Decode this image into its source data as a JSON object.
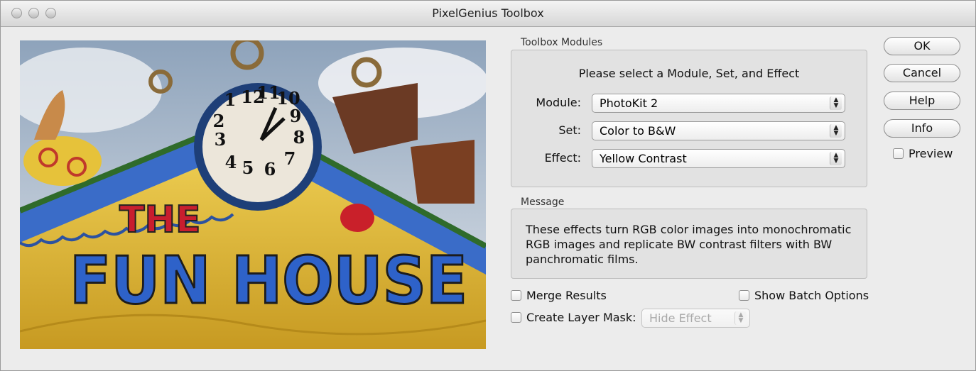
{
  "window": {
    "title": "PixelGenius Toolbox"
  },
  "preview_image": {
    "description_icon": "preview-photo",
    "sign_text_line1": "THE",
    "sign_text_line2": "FUN HOUSE",
    "clock_numbers": [
      "12",
      "11",
      "10",
      "9",
      "8",
      "7",
      "6",
      "5",
      "4",
      "3",
      "2",
      "1"
    ]
  },
  "modules": {
    "group_label": "Toolbox Modules",
    "prompt": "Please select a Module, Set, and Effect",
    "module_label": "Module:",
    "module_value": "PhotoKit 2",
    "set_label": "Set:",
    "set_value": "Color to B&W",
    "effect_label": "Effect:",
    "effect_value": "Yellow Contrast"
  },
  "message": {
    "group_label": "Message",
    "text": "These effects turn RGB color images into monochromatic RGB images and replicate BW contrast filters with BW panchromatic films."
  },
  "options": {
    "merge_results": "Merge Results",
    "show_batch_options": "Show Batch Options",
    "create_layer_mask": "Create Layer Mask:",
    "layer_mask_value": "Hide Effect"
  },
  "buttons": {
    "ok": "OK",
    "cancel": "Cancel",
    "help": "Help",
    "info": "Info",
    "preview": "Preview"
  },
  "colors": {
    "window_bg": "#ececec",
    "groupbox_bg": "#e2e2e2",
    "sky": "#b9c7d6",
    "wall_yellow": "#e8c33c",
    "trim_blue": "#3a6cc8"
  }
}
